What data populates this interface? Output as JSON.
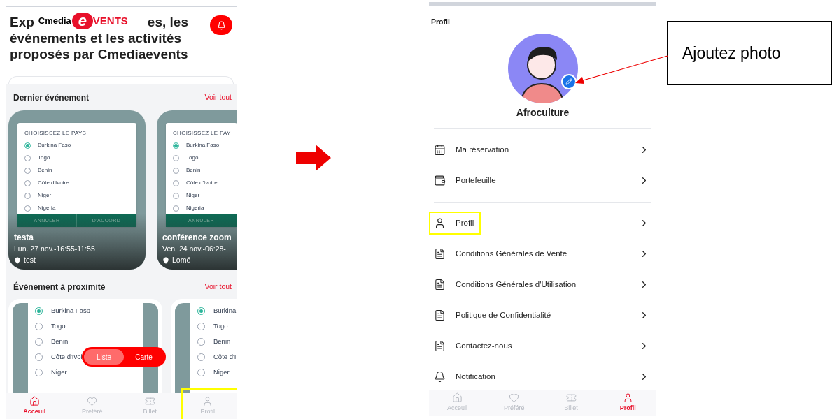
{
  "left_screen": {
    "logo": {
      "prefix": "Cmedia",
      "mark": "e",
      "suffix": "VENTS"
    },
    "headline": {
      "start": "Exp",
      "end": "es, les",
      "lines": [
        "événements et les activités",
        "proposés par Cmediaevents"
      ]
    },
    "featured": {
      "title": "Dernier événement",
      "link": "Voir tout",
      "cards": [
        {
          "poster": {
            "title": "CHOISISSEZ LE PAYS",
            "options": [
              {
                "label": "Burkina Faso",
                "selected": true
              },
              {
                "label": "Togo",
                "selected": false
              },
              {
                "label": "Benin",
                "selected": false
              },
              {
                "label": "Côte d'Ivoire",
                "selected": false
              },
              {
                "label": "Niger",
                "selected": false
              },
              {
                "label": "Nigeria",
                "selected": false
              }
            ],
            "buttons": [
              "ANNULER",
              "D'ACCORD"
            ]
          },
          "name": "testa",
          "date": "Lun. 27 nov.-16:55-11:55",
          "place": "test"
        },
        {
          "poster": {
            "title": "CHOISISSEZ LE PAY",
            "options": [
              {
                "label": "Burkina Faso",
                "selected": true
              },
              {
                "label": "Togo",
                "selected": false
              },
              {
                "label": "Benin",
                "selected": false
              },
              {
                "label": "Côte d'Ivoire",
                "selected": false
              },
              {
                "label": "Niger",
                "selected": false
              },
              {
                "label": "Nigeria",
                "selected": false
              }
            ],
            "buttons": [
              "ANNULER"
            ]
          },
          "name": "conférence zoom",
          "date": "Ven. 24 nov.-06:28-",
          "place": "Lomé"
        }
      ]
    },
    "nearby": {
      "title": "Événement à proximité",
      "link": "Voir tout",
      "cards": [
        {
          "options": [
            {
              "label": "Burkina Faso",
              "selected": true
            },
            {
              "label": "Togo",
              "selected": false
            },
            {
              "label": "Benin",
              "selected": false
            },
            {
              "label": "Côte d'Ivoi",
              "selected": false
            },
            {
              "label": "Niger",
              "selected": false
            }
          ]
        },
        {
          "options": [
            {
              "label": "Burkina",
              "selected": true
            },
            {
              "label": "Togo",
              "selected": false
            },
            {
              "label": "Benin",
              "selected": false
            },
            {
              "label": "Côte d'I",
              "selected": false
            },
            {
              "label": "Niger",
              "selected": false
            }
          ]
        }
      ]
    },
    "view_toggle": [
      {
        "label": "Liste",
        "selected": true
      },
      {
        "label": "Carte",
        "selected": false
      }
    ],
    "bottom_nav": [
      {
        "label": "Acceuil",
        "kind": "home",
        "selected": true,
        "highlighted": false
      },
      {
        "label": "Préféré",
        "kind": "heart",
        "selected": false,
        "highlighted": false
      },
      {
        "label": "Billet",
        "kind": "ticket",
        "selected": false,
        "highlighted": false
      },
      {
        "label": "Profil",
        "kind": "user",
        "selected": false,
        "highlighted": true
      }
    ]
  },
  "right_screen": {
    "title": "Profil",
    "user_name": "Afroculture",
    "menu_groups": [
      [
        {
          "label": "Ma réservation",
          "kind": "calendar",
          "highlighted": false
        },
        {
          "label": "Portefeuille",
          "kind": "wallet",
          "highlighted": false
        }
      ],
      [
        {
          "label": "Profil",
          "kind": "user",
          "highlighted": true
        },
        {
          "label": "Conditions Générales de Vente",
          "kind": "document",
          "highlighted": false
        },
        {
          "label": "Conditions Générales d'Utilisation",
          "kind": "document",
          "highlighted": false
        },
        {
          "label": "Politique de Confidentialité",
          "kind": "document",
          "highlighted": false
        },
        {
          "label": "Contactez-nous",
          "kind": "document",
          "highlighted": false
        },
        {
          "label": "Notification",
          "kind": "bell",
          "highlighted": false
        }
      ]
    ],
    "bottom_nav": [
      {
        "label": "Acceuil",
        "kind": "home",
        "selected": false,
        "highlighted": false
      },
      {
        "label": "Préféré",
        "kind": "heart",
        "selected": false,
        "highlighted": false
      },
      {
        "label": "Billet",
        "kind": "ticket",
        "selected": false,
        "highlighted": false
      },
      {
        "label": "Profil",
        "kind": "user",
        "selected": true,
        "highlighted": false
      }
    ]
  },
  "annotation": {
    "text": "Ajoutez photo"
  }
}
